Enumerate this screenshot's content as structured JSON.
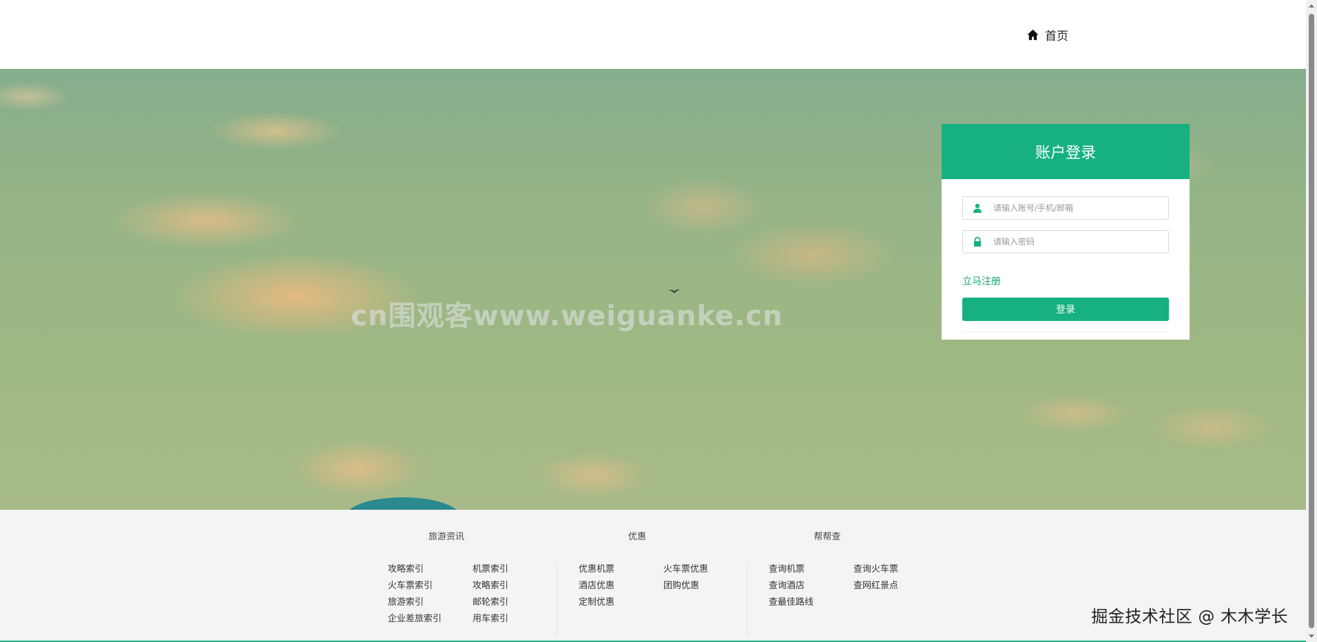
{
  "nav": {
    "home_label": "首页",
    "home_icon": "home-icon"
  },
  "hero": {
    "watermark": "cn围观客www.weiguanke.cn"
  },
  "login": {
    "title": "账户登录",
    "username_placeholder": "请输入账号/手机/邮箱",
    "username_value": "",
    "username_icon": "user-icon",
    "password_placeholder": "请输入密码",
    "password_value": "",
    "password_icon": "lock-icon",
    "register_label": "立马注册",
    "login_button_label": "登录",
    "accent_color": "#17b181"
  },
  "footer": {
    "columns": [
      {
        "title": "旅游资讯",
        "links": [
          "攻略索引",
          "机票索引",
          "火车票索引",
          "攻略索引",
          "旅游索引",
          "邮轮索引",
          "企业差旅索引",
          "用车索引"
        ]
      },
      {
        "title": "优惠",
        "links": [
          "优惠机票",
          "火车票优惠",
          "酒店优惠",
          "团购优惠",
          "定制优惠"
        ]
      },
      {
        "title": "帮帮查",
        "links": [
          "查询机票",
          "查询火车票",
          "查询酒店",
          "查网红景点",
          "查最佳路线"
        ]
      }
    ],
    "corner_watermark": "掘金技术社区 @ 木木学长"
  }
}
